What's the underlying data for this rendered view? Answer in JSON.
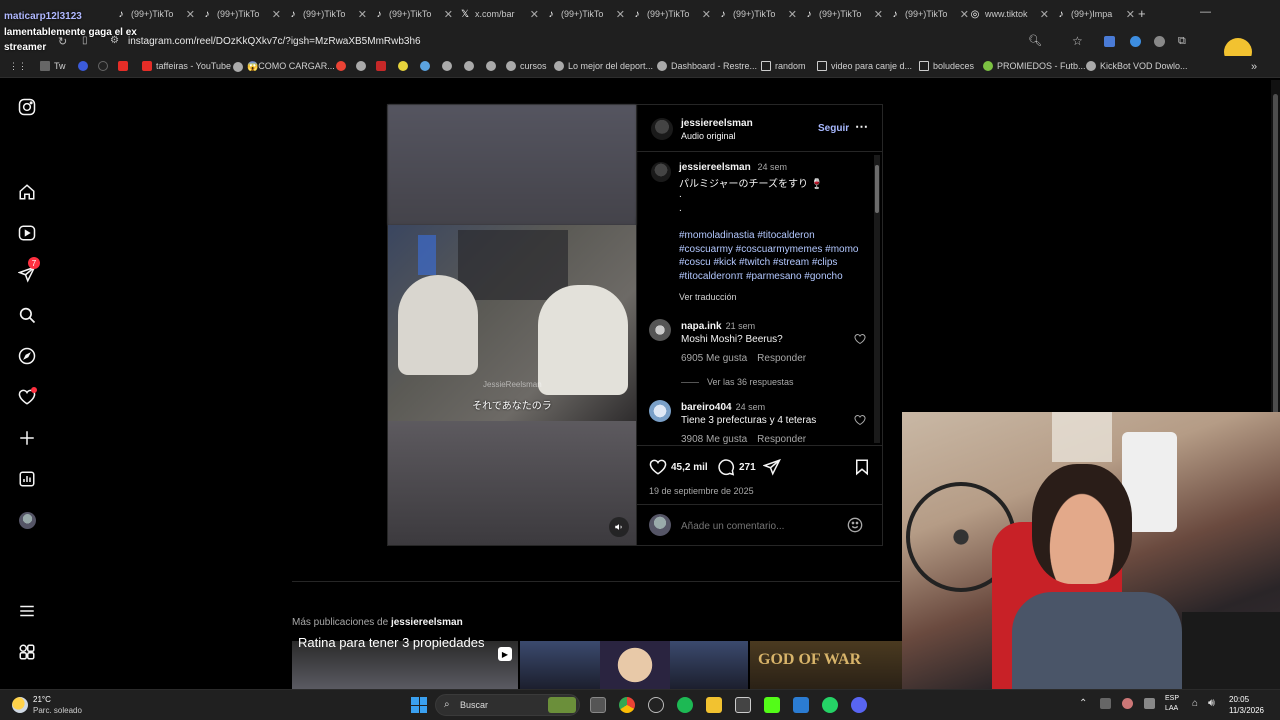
{
  "overlay": {
    "line1": "maticarp12l3123",
    "line2": "lamentablemente gaga el ex",
    "line3": "streamer"
  },
  "browser": {
    "tabs": [
      {
        "label": "(99+)TikTo"
      },
      {
        "label": "(99+)TikTo"
      },
      {
        "label": "(99+)TikTo"
      },
      {
        "label": "(99+)TikTo"
      },
      {
        "label": "x.com/bar"
      },
      {
        "label": "(99+)TikTo"
      },
      {
        "label": "(99+)TikTo"
      },
      {
        "label": "(99+)TikTo"
      },
      {
        "label": "(99+)TikTo"
      },
      {
        "label": "(99+)TikTo"
      },
      {
        "label": "www.tiktok"
      },
      {
        "label": "(99+)Impa"
      }
    ],
    "url": "instagram.com/reel/DOzKkQXkv7c/?igsh=MzRwaXB5MmRwb3h6",
    "bookmarks": [
      {
        "label": "Tw"
      },
      {
        "label": "taffeiras - YouTube"
      },
      {
        "label": "😱COMO CARGAR..."
      },
      {
        "label": "cursos"
      },
      {
        "label": "Lo mejor del deport..."
      },
      {
        "label": "Dashboard - Restre..."
      },
      {
        "label": "random"
      },
      {
        "label": "video para canje d..."
      },
      {
        "label": "boludeces"
      },
      {
        "label": "PROMIEDOS - Futb..."
      },
      {
        "label": "KickBot VOD Dowlo..."
      }
    ]
  },
  "sidebar": {
    "notification_count": "7"
  },
  "post": {
    "author": "jessiereelsman",
    "audio": "Audio original",
    "follow_label": "Seguir",
    "caption_time": "24 sem",
    "caption_text": "パルミジャーのチーズをすり 🍷",
    "dot1": ".",
    "dot2": ".",
    "hashtags": "#momoladinastia #titocalderon #coscuarmy #coscuarmymemes #momo #coscu #kick #twitch #stream #clips #titocalderonπ #parmesano #goncho",
    "translate_label": "Ver traducción",
    "subtitle": "それであなたのラ",
    "watermark": "JessieReelsman",
    "comments": [
      {
        "user": "napa.ink",
        "time": "21 sem",
        "text": "Moshi Moshi? Beerus?",
        "likes": "6905 Me gusta",
        "reply": "Responder"
      },
      {
        "user": "bareiro404",
        "time": "24 sem",
        "text": "Tiene 3 prefecturas y 4 teteras",
        "likes": "3908 Me gusta",
        "reply": "Responder"
      }
    ],
    "view_replies": "Ver las 36 respuestas",
    "like_count": "45,2 mil",
    "comment_count": "271",
    "date": "19 de septiembre de 2025",
    "add_comment_placeholder": "Añade un comentario..."
  },
  "more_posts": {
    "prefix": "Más publicaciones de",
    "author": "jessiereelsman",
    "thumb1_caption": "Ratina para tener 3 propiedades",
    "thumb3_caption": "GOD OF WAR"
  },
  "taskbar": {
    "temperature": "21°C",
    "weather": "Parc. soleado",
    "search_label": "Buscar",
    "lang1": "ESP",
    "lang2": "LAA",
    "time": "20:05",
    "date": "11/3/2026"
  }
}
